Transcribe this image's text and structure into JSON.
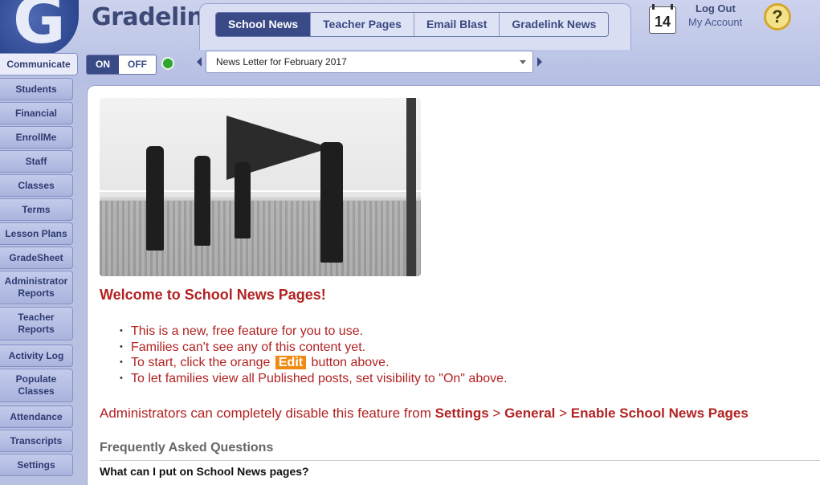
{
  "app": {
    "brand": "Gradelink",
    "logo_letter": "G"
  },
  "tabs": [
    {
      "label": "School News",
      "active": true
    },
    {
      "label": "Teacher Pages"
    },
    {
      "label": "Email Blast"
    },
    {
      "label": "Gradelink News"
    }
  ],
  "header": {
    "calendar_day": "14",
    "logout_label": "Log Out",
    "my_account_label": "My Account",
    "help_symbol": "?"
  },
  "controls": {
    "on_label": "ON",
    "off_label": "OFF",
    "selected_newsletter": "News Letter for February 2017"
  },
  "sidebar": {
    "items": [
      {
        "label": "Communicate",
        "active": true
      },
      {
        "label": "Students"
      },
      {
        "label": "Financial"
      },
      {
        "label": "EnrollMe"
      },
      {
        "label": "Staff"
      },
      {
        "label": "Classes"
      },
      {
        "label": "Terms"
      },
      {
        "label": "Lesson Plans"
      },
      {
        "label": "GradeSheet"
      },
      {
        "label": "Administrator Reports"
      },
      {
        "label": "Teacher Reports"
      },
      {
        "label": "Activity Log"
      },
      {
        "label": "Populate Classes"
      },
      {
        "label": "Attendance"
      },
      {
        "label": "Transcripts"
      },
      {
        "label": "Settings"
      }
    ]
  },
  "content": {
    "welcome_title": "Welcome to School News Pages!",
    "bullets": {
      "b1": "This is a new, free feature for you to use.",
      "b2": "Families can't see any of this content yet.",
      "b3_pre": "To start, click the orange",
      "b3_chip": "Edit",
      "b3_post": "button above.",
      "b4": "To let families view all Published posts, set visibility to \"On\" above."
    },
    "admin": {
      "text": "Administrators can completely disable this feature from",
      "path1": "Settings",
      "sep1": " > ",
      "path2": "General",
      "sep2": " > ",
      "path3": "Enable School News Pages"
    },
    "faq_title": "Frequently Asked Questions",
    "faq_q1": "What can I put on School News pages?"
  },
  "colors": {
    "accent": "#3a4a86",
    "content_red": "#b22222",
    "edit_orange": "#ef8b12",
    "status_green": "#2fa42f"
  },
  "icons": [
    "calendar-icon",
    "help-icon",
    "status-dot",
    "prev-arrow-icon",
    "next-arrow-icon",
    "dropdown-caret-icon"
  ]
}
